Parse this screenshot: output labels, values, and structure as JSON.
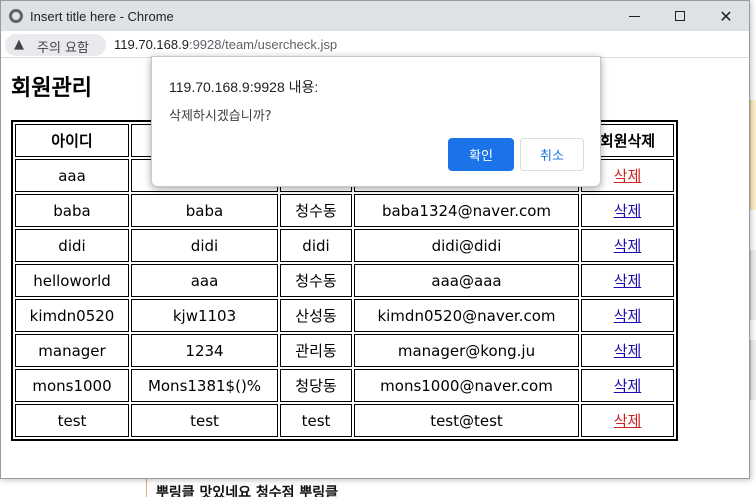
{
  "window": {
    "title": "Insert title here - Chrome"
  },
  "address": {
    "security_label": "주의 요함",
    "url_host": "119.70.168.9",
    "url_rest": ":9928/team/usercheck.jsp"
  },
  "page": {
    "title": "회원관리",
    "table": {
      "headers": [
        "아이디",
        "",
        "",
        "",
        "회원삭제"
      ],
      "rows": [
        {
          "id": "aaa",
          "pw": "",
          "addr": "",
          "email": "",
          "action": "삭제"
        },
        {
          "id": "baba",
          "pw": "baba",
          "addr": "청수동",
          "email": "baba1324@naver.com",
          "action": "삭제"
        },
        {
          "id": "didi",
          "pw": "didi",
          "addr": "didi",
          "email": "didi@didi",
          "action": "삭제"
        },
        {
          "id": "helloworld",
          "pw": "aaa",
          "addr": "청수동",
          "email": "aaa@aaa",
          "action": "삭제"
        },
        {
          "id": "kimdn0520",
          "pw": "kjw1103",
          "addr": "산성동",
          "email": "kimdn0520@naver.com",
          "action": "삭제"
        },
        {
          "id": "manager",
          "pw": "1234",
          "addr": "관리동",
          "email": "manager@kong.ju",
          "action": "삭제"
        },
        {
          "id": "mons1000",
          "pw": "Mons1381$()%",
          "addr": "청당동",
          "email": "mons1000@naver.com",
          "action": "삭제"
        },
        {
          "id": "test",
          "pw": "test",
          "addr": "test",
          "email": "test@test",
          "action": "삭제"
        }
      ]
    }
  },
  "dialog": {
    "origin": "119.70.168.9:9928 내용:",
    "message": "삭제하시겠습니까?",
    "ok_label": "확인",
    "cancel_label": "취소"
  },
  "background": {
    "footer_text": "뿌링클 맛있네요 청수점 뿌링클"
  },
  "colors": {
    "link": "#1a0dab",
    "visited_link": "#cc2222",
    "primary_button": "#1a73e8"
  }
}
